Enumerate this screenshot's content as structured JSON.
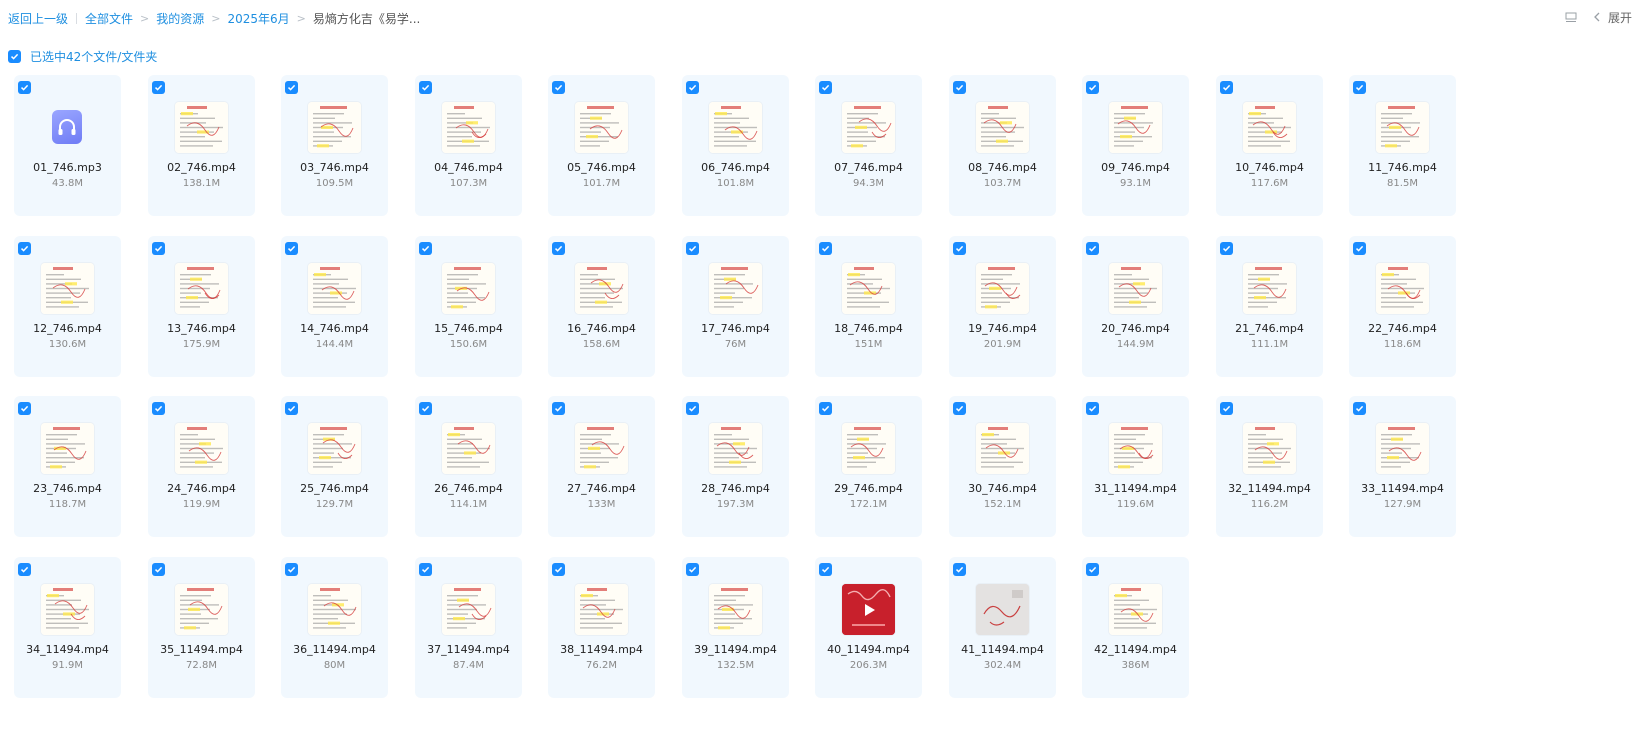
{
  "breadcrumb": {
    "back": "返回上一级",
    "items": [
      "全部文件",
      "我的资源",
      "2025年6月"
    ],
    "current": "易熵方化吉《易学..."
  },
  "toolbar": {
    "expand_label": "展开"
  },
  "selection": {
    "label": "已选中42个文件/文件夹"
  },
  "colors": {
    "accent": "#1a8cff",
    "card_bg": "#f1f8fe",
    "link": "#1f8fe0"
  },
  "files": [
    {
      "name": "01_746.mp3",
      "size": "43.8M",
      "kind": "audio"
    },
    {
      "name": "02_746.mp4",
      "size": "138.1M",
      "kind": "video"
    },
    {
      "name": "03_746.mp4",
      "size": "109.5M",
      "kind": "video"
    },
    {
      "name": "04_746.mp4",
      "size": "107.3M",
      "kind": "video"
    },
    {
      "name": "05_746.mp4",
      "size": "101.7M",
      "kind": "video"
    },
    {
      "name": "06_746.mp4",
      "size": "101.8M",
      "kind": "video"
    },
    {
      "name": "07_746.mp4",
      "size": "94.3M",
      "kind": "video"
    },
    {
      "name": "08_746.mp4",
      "size": "103.7M",
      "kind": "video"
    },
    {
      "name": "09_746.mp4",
      "size": "93.1M",
      "kind": "video"
    },
    {
      "name": "10_746.mp4",
      "size": "117.6M",
      "kind": "video"
    },
    {
      "name": "11_746.mp4",
      "size": "81.5M",
      "kind": "video"
    },
    {
      "name": "12_746.mp4",
      "size": "130.6M",
      "kind": "video"
    },
    {
      "name": "13_746.mp4",
      "size": "175.9M",
      "kind": "video"
    },
    {
      "name": "14_746.mp4",
      "size": "144.4M",
      "kind": "video"
    },
    {
      "name": "15_746.mp4",
      "size": "150.6M",
      "kind": "video"
    },
    {
      "name": "16_746.mp4",
      "size": "158.6M",
      "kind": "video"
    },
    {
      "name": "17_746.mp4",
      "size": "76M",
      "kind": "video"
    },
    {
      "name": "18_746.mp4",
      "size": "151M",
      "kind": "video"
    },
    {
      "name": "19_746.mp4",
      "size": "201.9M",
      "kind": "video"
    },
    {
      "name": "20_746.mp4",
      "size": "144.9M",
      "kind": "video"
    },
    {
      "name": "21_746.mp4",
      "size": "111.1M",
      "kind": "video"
    },
    {
      "name": "22_746.mp4",
      "size": "118.6M",
      "kind": "video"
    },
    {
      "name": "23_746.mp4",
      "size": "118.7M",
      "kind": "video"
    },
    {
      "name": "24_746.mp4",
      "size": "119.9M",
      "kind": "video"
    },
    {
      "name": "25_746.mp4",
      "size": "129.7M",
      "kind": "video"
    },
    {
      "name": "26_746.mp4",
      "size": "114.1M",
      "kind": "video"
    },
    {
      "name": "27_746.mp4",
      "size": "133M",
      "kind": "video"
    },
    {
      "name": "28_746.mp4",
      "size": "197.3M",
      "kind": "video"
    },
    {
      "name": "29_746.mp4",
      "size": "172.1M",
      "kind": "video"
    },
    {
      "name": "30_746.mp4",
      "size": "152.1M",
      "kind": "video"
    },
    {
      "name": "31_11494.mp4",
      "size": "119.6M",
      "kind": "video"
    },
    {
      "name": "32_11494.mp4",
      "size": "116.2M",
      "kind": "video"
    },
    {
      "name": "33_11494.mp4",
      "size": "127.9M",
      "kind": "video"
    },
    {
      "name": "34_11494.mp4",
      "size": "91.9M",
      "kind": "video"
    },
    {
      "name": "35_11494.mp4",
      "size": "72.8M",
      "kind": "video"
    },
    {
      "name": "36_11494.mp4",
      "size": "80M",
      "kind": "video"
    },
    {
      "name": "37_11494.mp4",
      "size": "87.4M",
      "kind": "video"
    },
    {
      "name": "38_11494.mp4",
      "size": "76.2M",
      "kind": "video"
    },
    {
      "name": "39_11494.mp4",
      "size": "132.5M",
      "kind": "video"
    },
    {
      "name": "40_11494.mp4",
      "size": "206.3M",
      "kind": "video-red"
    },
    {
      "name": "41_11494.mp4",
      "size": "302.4M",
      "kind": "video-photo"
    },
    {
      "name": "42_11494.mp4",
      "size": "386M",
      "kind": "video"
    }
  ]
}
